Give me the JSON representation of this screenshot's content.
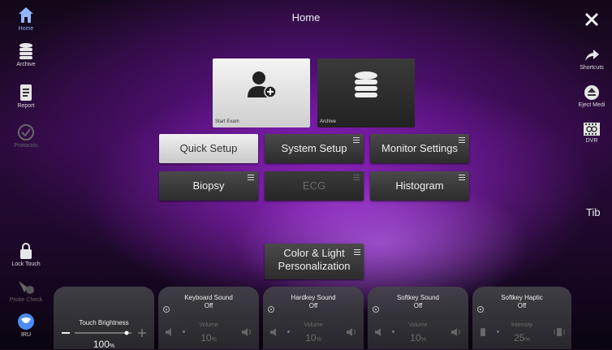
{
  "page": {
    "title": "Home"
  },
  "left_sidebar": {
    "items": [
      {
        "label": "Home",
        "icon": "home-icon"
      },
      {
        "label": "Archive",
        "icon": "database-icon"
      },
      {
        "label": "Report",
        "icon": "report-icon"
      },
      {
        "label": "Protocols",
        "icon": "checkmark-icon"
      },
      {
        "label": "Lock Touch",
        "icon": "lock-icon"
      },
      {
        "label": "Probe Check",
        "icon": "probe-icon"
      },
      {
        "label": "IRU",
        "icon": "iru-icon"
      }
    ]
  },
  "right_sidebar": {
    "close_icon": "close-icon",
    "items": [
      {
        "label": "Shortcuts",
        "icon": "shortcut-arrow-icon"
      },
      {
        "label": "Eject Medi",
        "icon": "eject-icon"
      },
      {
        "label": "DVR",
        "icon": "dvr-film-icon"
      }
    ],
    "tb_label": "Tib"
  },
  "tiles": {
    "start_exam": "Start Exam",
    "archive": "Archive"
  },
  "buttons": {
    "quick_setup": "Quick Setup",
    "system_setup": "System Setup",
    "monitor_settings": "Monitor Settings",
    "biopsy": "Biopsy",
    "ecg": "ECG",
    "histogram": "Histogram",
    "color_light_line1": "Color & Light",
    "color_light_line2": "Personalization"
  },
  "bottom_controls": {
    "touch_brightness": {
      "title": "Touch Brightness",
      "value": "100",
      "unit": "%"
    },
    "keyboard_sound": {
      "title": "Keyboard Sound",
      "state": "Off",
      "sub": "Volume",
      "value": "10",
      "unit": "%"
    },
    "hardkey_sound": {
      "title": "Hardkey Sound",
      "state": "Off",
      "sub": "Volume",
      "value": "10",
      "unit": "%"
    },
    "softkey_sound": {
      "title": "Softkey Sound",
      "state": "Off",
      "sub": "Volume",
      "value": "10",
      "unit": "%"
    },
    "softkey_haptic": {
      "title": "Softkey Haptic",
      "state": "Off",
      "sub": "Intensity",
      "value": "25",
      "unit": "%"
    }
  },
  "colors": {
    "accent_purple": "#7a1fa8",
    "button_dark": "#333333",
    "button_light": "#e6e6e6"
  }
}
